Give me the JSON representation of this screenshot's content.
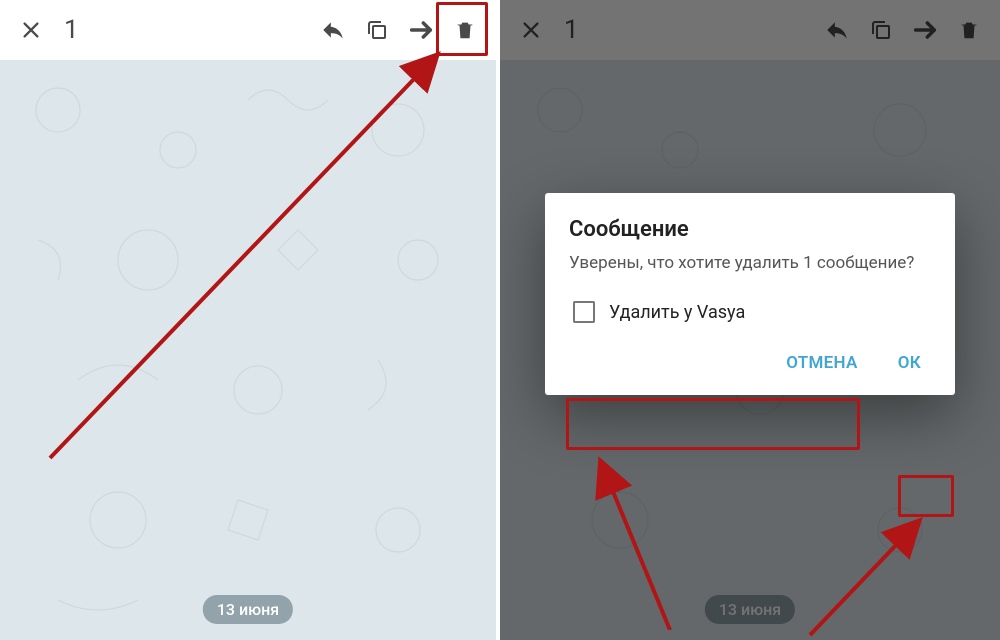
{
  "left": {
    "toolbar": {
      "selected_count": "1",
      "date_label": "13 июня"
    }
  },
  "right": {
    "toolbar": {
      "selected_count": "1",
      "date_label": "13 июня"
    },
    "dialog": {
      "title": "Сообщение",
      "body": "Уверены, что хотите удалить 1 сообщение?",
      "checkbox_label": "Удалить у Vasya",
      "cancel": "ОТМЕНА",
      "ok": "ОК"
    }
  },
  "colors": {
    "accent": "#3fa6d6",
    "highlight": "#b11515"
  }
}
